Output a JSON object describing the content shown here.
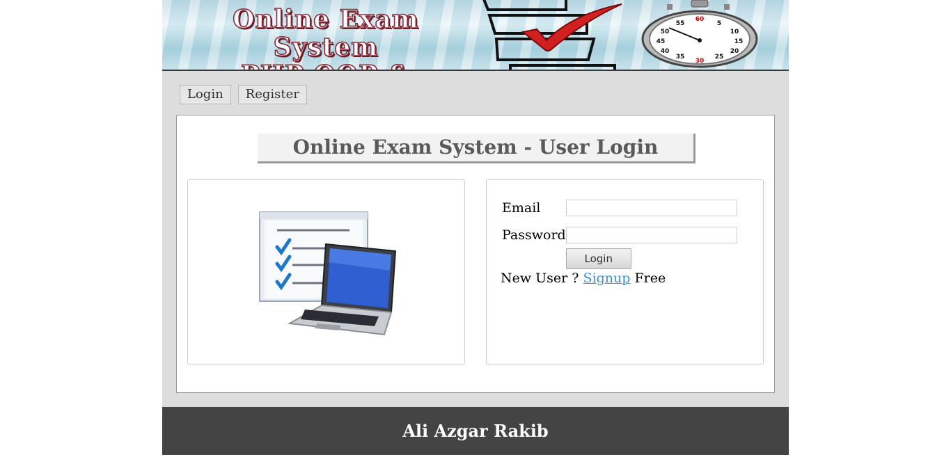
{
  "banner": {
    "title_line1": "Online Exam System",
    "title_line2": "PHP OOP & MySQLi",
    "clock_numbers": [
      "60",
      "5",
      "10",
      "15",
      "20",
      "25",
      "30",
      "35",
      "40",
      "45",
      "50",
      "55"
    ]
  },
  "menu": {
    "items": [
      {
        "label": "Login"
      },
      {
        "label": "Register"
      }
    ]
  },
  "main": {
    "heading": "Online Exam System - User Login",
    "form": {
      "email_label": "Email",
      "email_value": "",
      "password_label": "Password",
      "password_value": "",
      "login_button": "Login",
      "new_user_text": "New User ?",
      "signup_link": "Signup",
      "free_text": "Free"
    }
  },
  "footer": {
    "text": "Ali Azgar Rakib"
  },
  "colors": {
    "page_bg": "#dddddd",
    "footer_bg": "#444444",
    "link": "#3a8fd6",
    "checkmark_red": "#d21f1f",
    "check_blue": "#1f77c9"
  }
}
